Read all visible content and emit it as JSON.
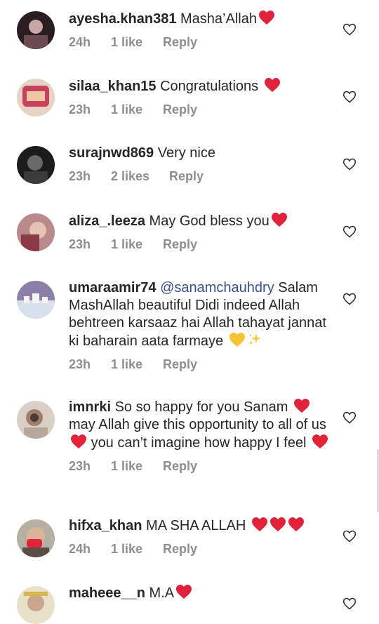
{
  "comments": [
    {
      "username": "ayesha.khan381",
      "text": "Masha’Allah",
      "time": "24h",
      "likes": "1 like",
      "reply": "Reply"
    },
    {
      "username": "silaa_khan15",
      "text": "Congratulations",
      "time": "23h",
      "likes": "1 like",
      "reply": "Reply"
    },
    {
      "username": "surajnwd869",
      "text": "Very nice",
      "time": "23h",
      "likes": "2 likes",
      "reply": "Reply"
    },
    {
      "username": "aliza_.leeza",
      "text": "May God bless you",
      "time": "23h",
      "likes": "1 like",
      "reply": "Reply"
    },
    {
      "username": "umaraamir74",
      "mention": "@sanamchauhdry",
      "text": "Salam MashAllah beautiful Didi indeed Allah behtreen karsaaz hai Allah tahayat jannat ki baharain aata farmaye",
      "time": "23h",
      "likes": "1 like",
      "reply": "Reply"
    },
    {
      "username": "imnrki",
      "text_1": "So so happy for you Sanam",
      "text_2": "may Allah give this opportunity to all of us",
      "text_3": "you can’t imagine how happy I feel",
      "time": "23h",
      "likes": "1 like",
      "reply": "Reply"
    },
    {
      "username": "hifxa_khan",
      "text": "MA SHA ALLAH",
      "time": "24h",
      "likes": "1 like",
      "reply": "Reply"
    },
    {
      "username": "maheee__n",
      "text": "M.A"
    }
  ],
  "icons": {
    "like": "heart-outline-icon",
    "emoji_heart": "red-heart-emoji",
    "emoji_yellow": "yellow-heart-emoji",
    "emoji_sparkles": "sparkles-emoji"
  },
  "colors": {
    "text": "#262626",
    "meta": "#8e8e8e",
    "mention": "#385185",
    "heart": "#e0223a"
  }
}
